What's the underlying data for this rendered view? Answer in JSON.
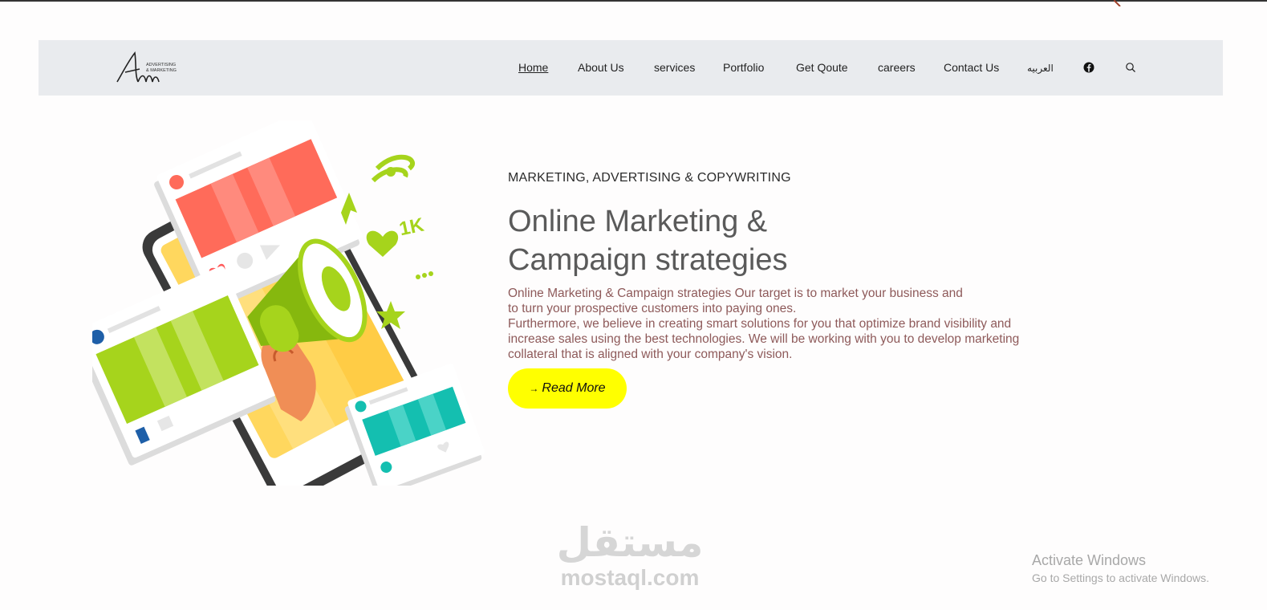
{
  "nav": {
    "items": [
      {
        "label": "Home",
        "active": true
      },
      {
        "label": "About Us"
      },
      {
        "label": "services"
      },
      {
        "label": "Portfolio"
      },
      {
        "label": "Get Qoute"
      },
      {
        "label": "careers"
      },
      {
        "label": "Contact Us"
      },
      {
        "label": "العربيه"
      }
    ],
    "icons": [
      "facebook-icon",
      "search-icon"
    ]
  },
  "logo": {
    "script_mark": "Am",
    "tagline_1": "ADVERTISING",
    "tagline_2": "& MARKETING"
  },
  "hero": {
    "eyebrow": "MARKETING, ADVERTISING & COPYWRITING",
    "title_line1": "Online Marketing &",
    "title_line2": "Campaign strategies",
    "body_line1": "Online Marketing & Campaign strategies Our target is to market your business and",
    "body_line2": "to turn your prospective customers into paying ones.",
    "body_line3": "Furthermore, we believe in creating smart solutions for you that optimize brand visibility and",
    "body_line4": "increase sales using the best technologies. We will be working with you to develop marketing",
    "body_line5": "collateral that is aligned with your company's vision.",
    "cta": "Read More",
    "illustration_badge": "1K"
  },
  "watermark": {
    "arabic": "مستقل",
    "latin": "mostaql.com"
  },
  "os_overlay": {
    "title": "Activate Windows",
    "subtitle": "Go to Settings to activate Windows."
  },
  "colors": {
    "nav_bg": "#e9ebee",
    "cta_bg": "#ffff00",
    "title": "#5a5a5a",
    "body": "#8e5a5a"
  }
}
